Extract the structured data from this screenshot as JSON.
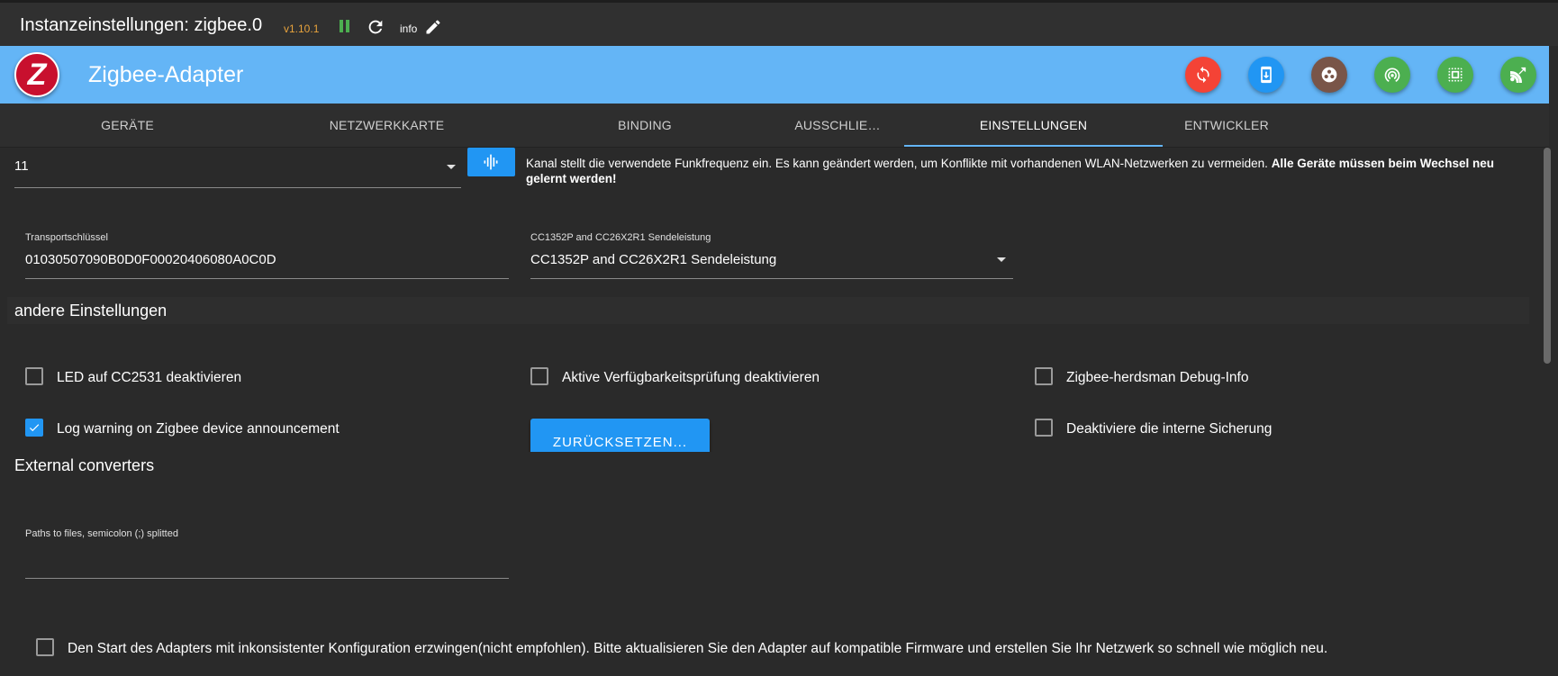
{
  "titlebar": {
    "title": "Instanzeinstellungen: zigbee.0",
    "version": "v1.10.1",
    "info_label": "info",
    "icons": [
      "pause-icon",
      "refresh-icon",
      "pencil-icon"
    ]
  },
  "header": {
    "logo_text": "Z",
    "title": "Zigbee-Adapter",
    "buttons": [
      {
        "name": "sync-button",
        "icon": "sync-icon",
        "color": "#f44336"
      },
      {
        "name": "device-update-button",
        "icon": "phone-download-icon",
        "color": "#2196f3"
      },
      {
        "name": "groups-button",
        "icon": "group-icon",
        "color": "#795548"
      },
      {
        "name": "pairing-button",
        "icon": "wifi-tethering-icon",
        "color": "#4caf50"
      },
      {
        "name": "select-all-button",
        "icon": "select-icon",
        "color": "#4caf50"
      },
      {
        "name": "network-button",
        "icon": "signal-icon",
        "color": "#4caf50"
      }
    ]
  },
  "tabs": [
    {
      "label": "GERÄTE"
    },
    {
      "label": "NETZWERKKARTE"
    },
    {
      "label": "BINDING"
    },
    {
      "label": "AUSSCHLIE…"
    },
    {
      "label": "EINSTELLUNGEN",
      "active": true
    },
    {
      "label": "ENTWICKLER"
    }
  ],
  "channel": {
    "value": "11",
    "info_text": "Kanal stellt die verwendete Funkfrequenz ein. Es kann geändert werden, um Konflikte mit vorhandenen WLAN-Netzwerken zu vermeiden. ",
    "info_bold": "Alle Geräte müssen beim Wechsel neu gelernt werden!"
  },
  "transport_key": {
    "label": "Transportschlüssel",
    "value": "01030507090B0D0F00020406080A0C0D"
  },
  "power": {
    "label": "CC1352P and CC26X2R1 Sendeleistung",
    "value": "CC1352P and CC26X2R1 Sendeleistung"
  },
  "other_settings": {
    "title": "andere Einstellungen",
    "checkboxes": [
      {
        "label": "LED auf CC2531 deaktivieren",
        "checked": false
      },
      {
        "label": "Aktive Verfügbarkeitsprüfung deaktivieren",
        "checked": false
      },
      {
        "label": "Zigbee-herdsman Debug-Info",
        "checked": false
      },
      {
        "label": "Log warning on Zigbee device announcement",
        "checked": true
      },
      {
        "label": "Deaktiviere die interne Sicherung",
        "checked": false
      }
    ],
    "reset_label": "ZURÜCKSETZEN..."
  },
  "external": {
    "title": "External converters",
    "field_label": "Paths to files, semicolon (;) splitted",
    "field_value": ""
  },
  "force_start": {
    "label": "Den Start des Adapters mit inkonsistenter Konfiguration erzwingen(nicht empfohlen). Bitte aktualisieren Sie den Adapter auf kompatible Firmware und erstellen Sie Ihr Netzwerk so schnell wie möglich neu.",
    "checked": false
  }
}
